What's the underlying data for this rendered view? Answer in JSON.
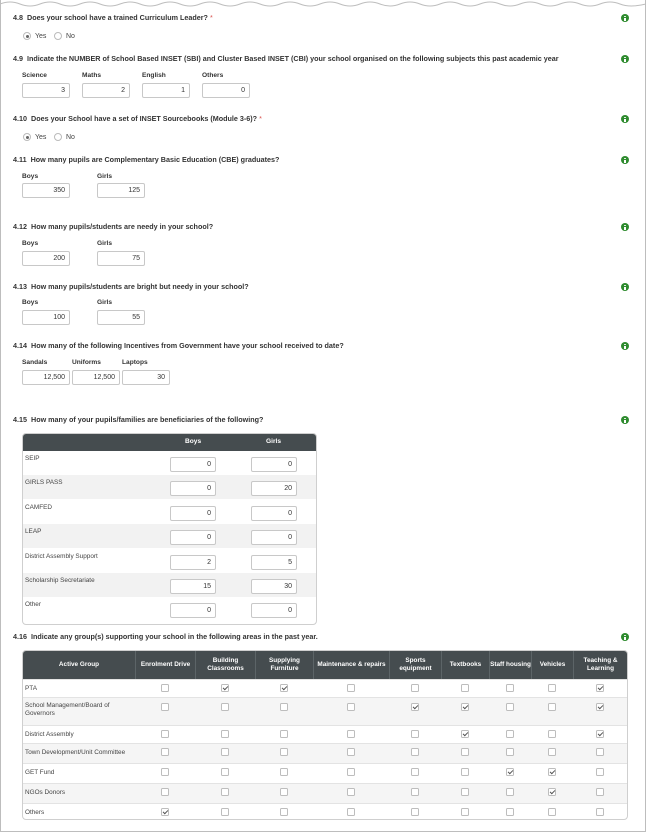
{
  "q48": {
    "num": "4.8",
    "text": "Does your school have a trained Curriculum Leader?",
    "req": "*",
    "options": [
      "Yes",
      "No"
    ],
    "selected": "Yes"
  },
  "q49": {
    "num": "4.9",
    "text": "Indicate the NUMBER of School Based INSET (SBI) and Cluster Based INSET (CBI) your school organised on the following subjects this past academic year",
    "fields": [
      {
        "label": "Science",
        "value": "3"
      },
      {
        "label": "Maths",
        "value": "2"
      },
      {
        "label": "English",
        "value": "1"
      },
      {
        "label": "Others",
        "value": "0"
      }
    ]
  },
  "q410": {
    "num": "4.10",
    "text": "Does your School have a set of INSET Sourcebooks (Module 3-6)?",
    "req": "*",
    "options": [
      "Yes",
      "No"
    ],
    "selected": "Yes"
  },
  "q411": {
    "num": "4.11",
    "text": "How many pupils are Complementary Basic Education (CBE) graduates?",
    "fields": [
      {
        "label": "Boys",
        "value": "350"
      },
      {
        "label": "Girls",
        "value": "125"
      }
    ]
  },
  "q412": {
    "num": "4.12",
    "text": "How many pupils/students are needy in your school?",
    "fields": [
      {
        "label": "Boys",
        "value": "200"
      },
      {
        "label": "Girls",
        "value": "75"
      }
    ]
  },
  "q413": {
    "num": "4.13",
    "text": "How many pupils/students are bright but needy in your school?",
    "fields": [
      {
        "label": "Boys",
        "value": "100"
      },
      {
        "label": "Girls",
        "value": "55"
      }
    ]
  },
  "q414": {
    "num": "4.14",
    "text": "How many of the following Incentives from Government have your school received to date?",
    "fields": [
      {
        "label": "Sandals",
        "value": "12,500"
      },
      {
        "label": "Uniforms",
        "value": "12,500"
      },
      {
        "label": "Laptops",
        "value": "30"
      }
    ]
  },
  "q415": {
    "num": "4.15",
    "text": "How many of your pupils/families are beneficiaries of the following?",
    "columns": [
      "Boys",
      "Girls"
    ],
    "rows": [
      {
        "label": "SEIP",
        "boys": "0",
        "girls": "0"
      },
      {
        "label": "GIRLS PASS",
        "boys": "0",
        "girls": "20"
      },
      {
        "label": "CAMFED",
        "boys": "0",
        "girls": "0"
      },
      {
        "label": "LEAP",
        "boys": "0",
        "girls": "0"
      },
      {
        "label": "District Assembly Support",
        "boys": "2",
        "girls": "5"
      },
      {
        "label": "Scholarship Secretariate",
        "boys": "15",
        "girls": "30"
      },
      {
        "label": "Other",
        "boys": "0",
        "girls": "0"
      }
    ]
  },
  "q416": {
    "num": "4.16",
    "text": "Indicate any group(s) supporting your school in the following areas in the past year.",
    "columns": [
      "Active Group",
      "Enrolment Drive",
      "Building Classrooms",
      "Supplying Furniture",
      "Maintenance & repairs",
      "Sports equipment",
      "Textbooks",
      "Staff housing",
      "Vehicles",
      "Teaching & Learning"
    ],
    "rows": [
      {
        "label": "PTA",
        "checks": [
          0,
          1,
          1,
          0,
          0,
          0,
          0,
          0,
          1
        ]
      },
      {
        "label": "School Management/Board of Governors",
        "checks": [
          0,
          0,
          0,
          0,
          1,
          1,
          0,
          0,
          1
        ]
      },
      {
        "label": "District Assembly",
        "checks": [
          0,
          0,
          0,
          0,
          0,
          1,
          0,
          0,
          1
        ]
      },
      {
        "label": "Town Development/Unit Committee",
        "checks": [
          0,
          0,
          0,
          0,
          0,
          0,
          0,
          0,
          0
        ]
      },
      {
        "label": "GET Fund",
        "checks": [
          0,
          0,
          0,
          0,
          0,
          0,
          1,
          1,
          0
        ]
      },
      {
        "label": "NGOs Donors",
        "checks": [
          0,
          0,
          0,
          0,
          0,
          0,
          0,
          1,
          0
        ]
      },
      {
        "label": "Others",
        "checks": [
          1,
          0,
          0,
          0,
          0,
          0,
          0,
          0,
          0
        ]
      }
    ]
  },
  "colors": {
    "header_bg": "#454c4f",
    "info_icon": "#2e8b2e",
    "required": "#d9534f"
  },
  "icons": {
    "info": "info-circle-icon",
    "radio": "radio-icon",
    "checkbox": "checkbox-icon"
  }
}
